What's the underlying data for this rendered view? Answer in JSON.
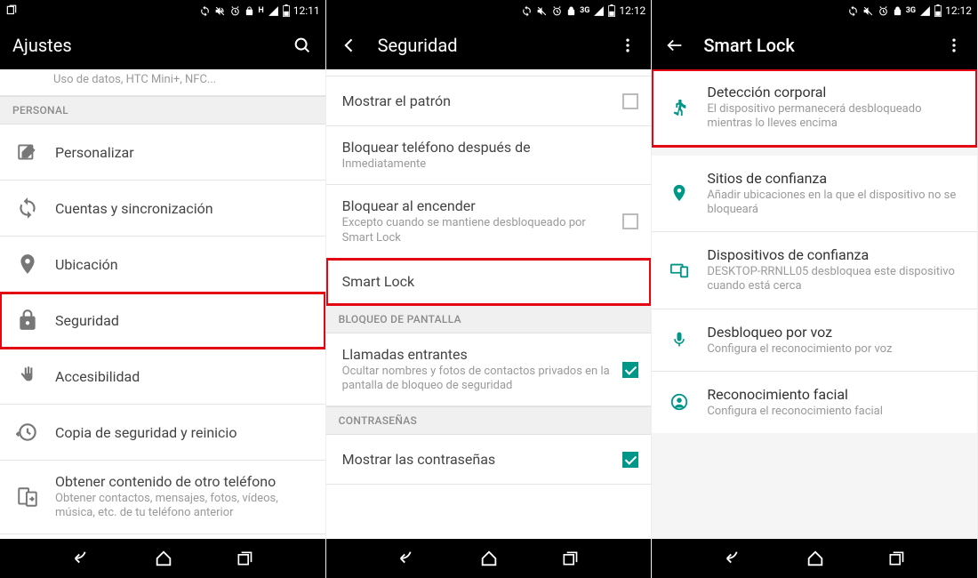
{
  "phone1": {
    "status_time": "12:11",
    "appbar_title": "Ajustes",
    "snippet_above": "Uso de datos, HTC Mini+, NFC...",
    "section_personal": "PERSONAL",
    "items": {
      "personalize": "Personalizar",
      "accounts": "Cuentas y sincronización",
      "location": "Ubicación",
      "security": "Seguridad",
      "accessibility": "Accesibilidad",
      "backup": "Copia de seguridad y reinicio",
      "get_content": "Obtener contenido de otro teléfono",
      "get_content_sub": "Obtener contactos, mensajes, fotos, vídeos, música, etc. de tu teléfono anterior"
    }
  },
  "phone2": {
    "status_time": "12:12",
    "appbar_title": "Seguridad",
    "items": {
      "show_pattern": "Mostrar el patrón",
      "lock_after": "Bloquear teléfono después de",
      "lock_after_sub": "Inmediatamente",
      "lock_power": "Bloquear al encender",
      "lock_power_sub": "Excepto cuando se mantiene desbloqueado por Smart Lock",
      "smart_lock": "Smart Lock",
      "section_lockscreen": "BLOQUEO DE PANTALLA",
      "incoming_calls": "Llamadas entrantes",
      "incoming_calls_sub": "Ocultar nombres y fotos de contactos privados en la pantalla de bloqueo de seguridad",
      "section_passwords": "CONTRASEÑAS",
      "show_passwords": "Mostrar las contraseñas"
    }
  },
  "phone3": {
    "status_time": "12:12",
    "appbar_title": "Smart Lock",
    "items": {
      "body": "Detección corporal",
      "body_sub": "El dispositivo permanecerá desbloqueado mientras lo lleves encima",
      "places": "Sitios de confianza",
      "places_sub": "Añadir ubicaciones en la que el dispositivo no se bloqueará",
      "devices": "Dispositivos de confianza",
      "devices_sub": "DESKTOP-RRNLL05 desbloquea este dispositivo cuando está cerca",
      "voice": "Desbloqueo por voz",
      "voice_sub": "Configura el reconocimiento por voz",
      "face": "Reconocimiento facial",
      "face_sub": "Configura el reconocimiento facial"
    }
  }
}
